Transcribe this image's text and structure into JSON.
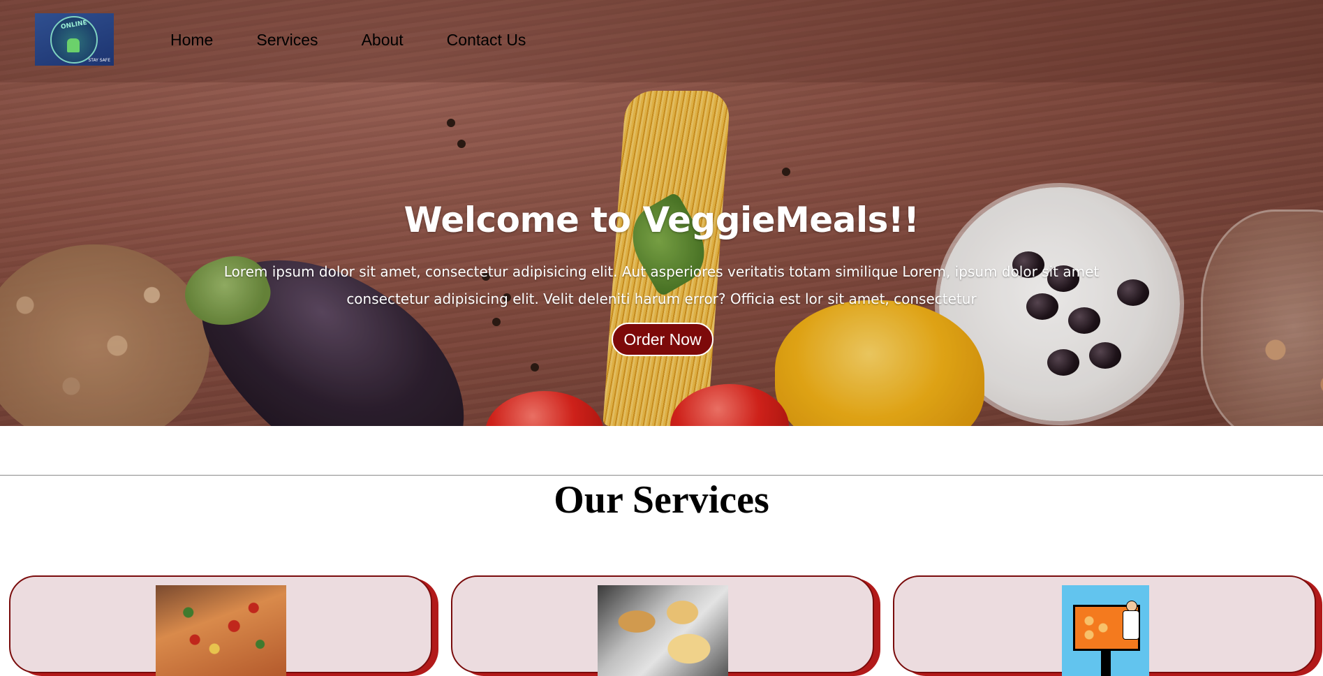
{
  "brand": {
    "logo_text": "ONLINE",
    "logo_badge": "STAY SAFE",
    "logo_icon": "delivery-scooter-icon"
  },
  "nav": {
    "items": [
      {
        "label": "Home"
      },
      {
        "label": "Services"
      },
      {
        "label": "About"
      },
      {
        "label": "Contact Us"
      }
    ]
  },
  "hero": {
    "title": "Welcome to VeggieMeals!!",
    "text": "Lorem ipsum dolor sit amet, consectetur adipisicing elit. Aut asperiores veritatis totam similique Lorem, ipsum dolor sit amet consectetur adipisicing elit. Velit deleniti harum error? Officia est lor sit amet, consectetur",
    "button_label": "Order Now"
  },
  "services": {
    "title": "Our Services",
    "cards": [
      {
        "image": "pizza-image"
      },
      {
        "image": "meal-platter-image"
      },
      {
        "image": "chef-menu-board-image"
      }
    ]
  },
  "colors": {
    "accent": "#7d0a0a",
    "card_bg": "#ecdcdf",
    "card_shadow": "#b21a1a"
  }
}
